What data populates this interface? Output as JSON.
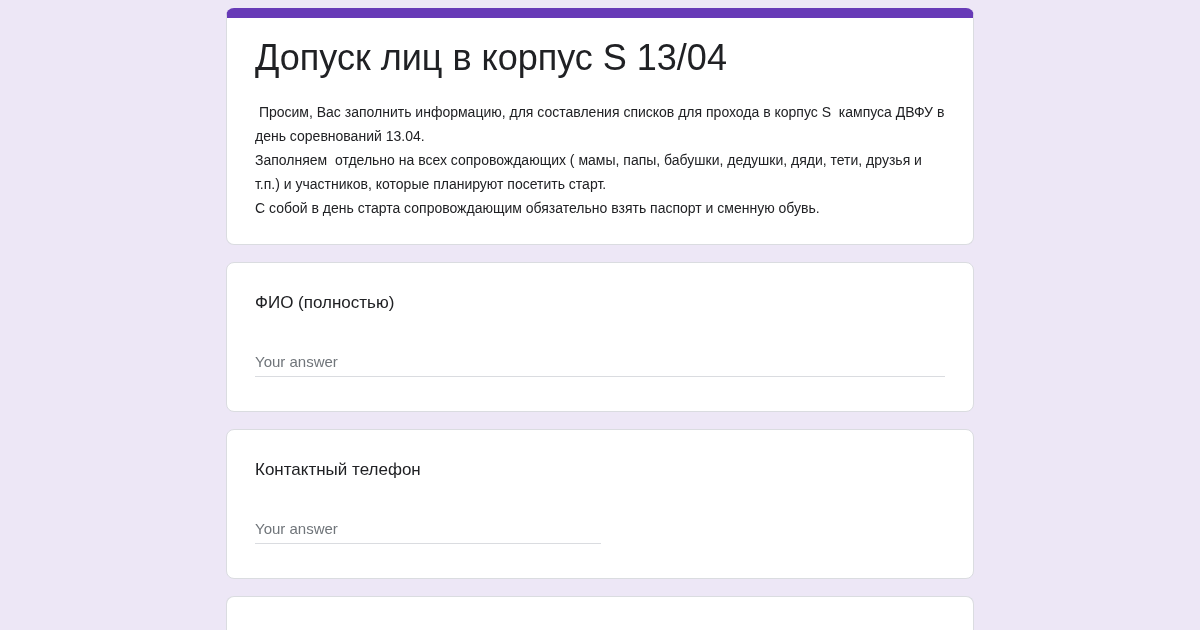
{
  "form": {
    "title": "Допуск лиц в корпус S 13/04",
    "description": [
      " Просим, Вас заполнить информацию, для составления списков для прохода в корпус S  кампуса ДВФУ в день соревнований 13.04.",
      "Заполняем  отдельно на всех сопровождающих ( мамы, папы, бабушки, дедушки, дяди, тети, друзья и т.п.) и участников, которые планируют посетить старт.",
      "С собой в день старта сопровождающим обязательно взять паспорт и сменную обувь."
    ]
  },
  "questions": [
    {
      "label": "ФИО (полностью)",
      "kind": "wide",
      "placeholder": "Your answer"
    },
    {
      "label": "Контактный телефон",
      "kind": "narrow",
      "placeholder": "Your answer"
    }
  ]
}
